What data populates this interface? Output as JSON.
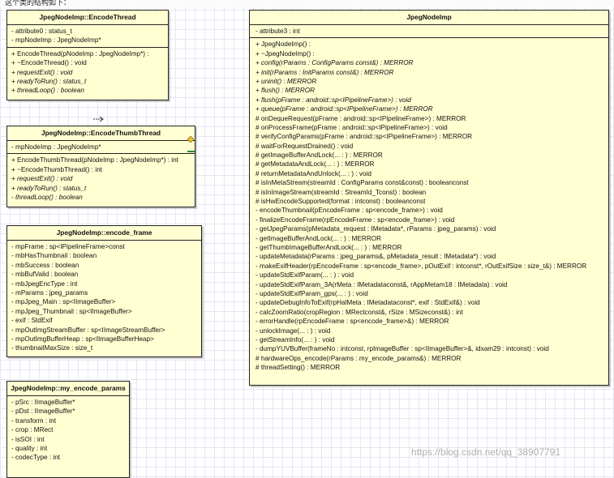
{
  "header_text": "这个类的结构如下：",
  "classes": {
    "encode_thread": {
      "title": "JpegNodeImp::EncodeThread",
      "attributes": [
        "- attribute0 : status_t",
        "- mpNodeImp : JpegNodeImp*"
      ],
      "methods": [
        {
          "text": "+ EncodeThread(pNodeImp : JpegNodeImp*) :",
          "italic": false
        },
        {
          "text": "+ ~EncodeThread() : void",
          "italic": false
        },
        {
          "text": "+ requestExit() : void",
          "italic": true
        },
        {
          "text": "+ readyToRun() : status_t",
          "italic": true
        },
        {
          "text": "+ threadLoop() : boolean",
          "italic": true
        }
      ]
    },
    "encode_thumb_thread": {
      "title": "JpegNodeImp::EncodeThumbThread",
      "attributes": [
        "- mpNodeImp : JpegNodeImp*"
      ],
      "methods": [
        {
          "text": "+ EncodeThumbThread(pNodeImp : JpegNodeImp*) : int",
          "italic": false
        },
        {
          "text": "+ ~EncodeThumbThread() : int",
          "italic": false
        },
        {
          "text": "+ requestExit() : void",
          "italic": true
        },
        {
          "text": "+ readyToRun() : status_t",
          "italic": true
        },
        {
          "text": "- threadLoop() : boolean",
          "italic": true
        }
      ]
    },
    "encode_frame": {
      "title": "JpegNodeImp::encode_frame",
      "attributes": [
        "- mpFrame : sp<IPipelineFrame>const",
        "- mbHasThumbnail : boolean",
        "- mbSuccess : boolean",
        "- mbBufValid : boolean",
        "- mbJpegEncType : int",
        "- mParams : jpeg_params",
        "- mpJpeg_Main : sp<IImageBuffer>",
        "- mpJpeg_Thumbnail : sp<IImageBuffer>",
        "- exif : StdExif",
        "- mpOutImgStreamBuffer : sp<IImageStreamBuffer>",
        "- mpOutImgBufferHeap : sp<IImageBufferHeap>",
        "- thumbnailMaxSize : size_t"
      ]
    },
    "my_encode_params": {
      "title": "JpegNodeImp::my_encode_params",
      "attributes": [
        "- pSrc : IImageBuffer*",
        "- pDst : IImageBuffer*",
        "- transform : int",
        "- crop : MRect",
        "- isSOI : int",
        "- quality : int",
        "- codecType : int"
      ]
    },
    "jpeg_node_imp": {
      "title": "JpegNodeImp",
      "attributes": [
        "- attribute3 : int"
      ],
      "methods": [
        {
          "text": "+ JpegNodeImp() :",
          "italic": false
        },
        {
          "text": "+ ~JpegNodeImp() :",
          "italic": false
        },
        {
          "text": "+ config(rParams : ConfigParams const&) : MERROR",
          "italic": true
        },
        {
          "text": "+ init(rParams : InitParams const&) : MERROR",
          "italic": true
        },
        {
          "text": "+ uninit() : MERROR",
          "italic": true
        },
        {
          "text": "+ flush() : MERROR",
          "italic": true
        },
        {
          "text": "+ flush(pFrame : android::sp<IPipelineFrame>) : void",
          "italic": true
        },
        {
          "text": "+ queue(pFrame : android::sp<IPipelineFrame>) : MERROR",
          "italic": true
        },
        {
          "text": "# onDequeRequest(pFrame : android::sp<IPipelineFrame>) : MERROR",
          "italic": false
        },
        {
          "text": "# onProcessFrame(pFrame : android::sp<IPipelineFrame>) : void",
          "italic": false
        },
        {
          "text": "# verifyConfigParams(pFrame : android::sp<IPipelineFrame>) : MERROR",
          "italic": false
        },
        {
          "text": "# waitForRequestDrained() : void",
          "italic": false
        },
        {
          "text": "# getImageBufferAndLock(... : ) : MERROR",
          "italic": false
        },
        {
          "text": "# getMetadataAndLock(... : ) : MERROR",
          "italic": false
        },
        {
          "text": "# returnMetadataAndUnlock(... : ) : void",
          "italic": false
        },
        {
          "text": "# isInMetaStream(streamId : ConfigParams const&const) : booleanconst",
          "italic": false
        },
        {
          "text": "# isInImageStream(streamId : StreamId_Tconst) : boolean",
          "italic": false
        },
        {
          "text": "# isHwEncodeSupported(format : intconst) : booleanconst",
          "italic": false
        },
        {
          "text": "- encodeThumbnail(pEncodeFrame : sp<encode_frame>) : void",
          "italic": false
        },
        {
          "text": "- finalizeEncodeFrame(rpEncodeFrame : sp<encode_frame>) : void",
          "italic": false
        },
        {
          "text": "- getJpegParams(pMetadata_request : IMetadata*, rParams : jpeg_params) : void",
          "italic": false
        },
        {
          "text": "- getImageBufferAndLock(... : ) : MERROR",
          "italic": false
        },
        {
          "text": "- getThumbImageBufferAndLock(... : ) : MERROR",
          "italic": false
        },
        {
          "text": "- updateMetadata(rParams : jpeg_params&, pMetadata_result : IMetadata*) : void",
          "italic": false
        },
        {
          "text": "- makeExifHeader(rpEncodeFrame : sp<encode_frame>, pOutExif : intconst*, rOutExifSize : size_t&) : MERROR",
          "italic": false
        },
        {
          "text": "- updateStdExifParam(... : ) : void",
          "italic": false
        },
        {
          "text": "- updateStdExifParam_3A(rMeta : IMetadataconst&, rAppMetam18 : IMetadata) : void",
          "italic": false
        },
        {
          "text": "- updateStdExifParam_gps(... : ) : void",
          "italic": false
        },
        {
          "text": "- updateDebugInfoToExif(rpHalMeta : IMetadataconst*, exif : StdExif&) : void",
          "italic": false
        },
        {
          "text": "- calcZoomRatio(cropRegion : MRectconst&, rSize : MSizeconst&) : int",
          "italic": false
        },
        {
          "text": "- errorHandle(rpEncodeFrame : sp<encode_frame>&) : MERROR",
          "italic": false
        },
        {
          "text": "- unlockImage(... : ) : void",
          "italic": false
        },
        {
          "text": "- getStreamInfo(... : ) : void",
          "italic": false
        },
        {
          "text": "- dumpYUVBuffer(frameNo : intconst, rpImageBuffer : sp<IImageBuffer>&, idxam29 : intconst) : void",
          "italic": false
        },
        {
          "text": "# hardwareOps_encode(rParams : my_encode_params&) : MERROR",
          "italic": false
        },
        {
          "text": "# threadSetting() : MERROR",
          "italic": false
        }
      ]
    }
  },
  "watermark": "https://blog.csdn.net/qq_38907791",
  "colors": {
    "class_fill": "#ffffd2",
    "border": "#222222",
    "grid": "#e6e6f4",
    "connector_marker": "#2e8b2e"
  }
}
